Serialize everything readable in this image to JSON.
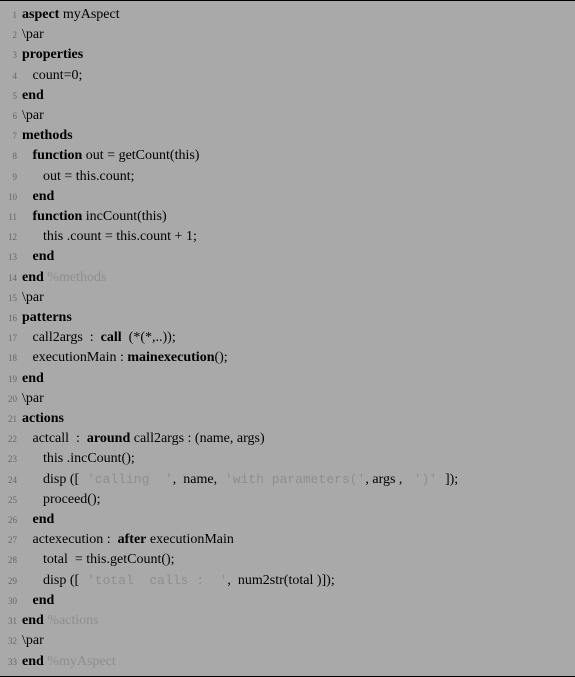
{
  "lines": [
    {
      "n": "1",
      "segs": [
        {
          "t": "aspect",
          "c": "kw"
        },
        {
          "t": " myAspect"
        }
      ]
    },
    {
      "n": "2",
      "segs": [
        {
          "t": "\\par"
        }
      ]
    },
    {
      "n": "3",
      "segs": [
        {
          "t": "properties",
          "c": "kw"
        }
      ]
    },
    {
      "n": "4",
      "segs": [
        {
          "t": "   count=0;"
        }
      ]
    },
    {
      "n": "5",
      "segs": [
        {
          "t": "end",
          "c": "kw"
        }
      ]
    },
    {
      "n": "6",
      "segs": [
        {
          "t": "\\par"
        }
      ]
    },
    {
      "n": "7",
      "segs": [
        {
          "t": "methods",
          "c": "kw"
        }
      ]
    },
    {
      "n": "8",
      "segs": [
        {
          "t": "   "
        },
        {
          "t": "function",
          "c": "kw"
        },
        {
          "t": " out = getCount(this)"
        }
      ]
    },
    {
      "n": "9",
      "segs": [
        {
          "t": "      out = this.count;"
        }
      ]
    },
    {
      "n": "10",
      "segs": [
        {
          "t": "   "
        },
        {
          "t": "end",
          "c": "kw"
        }
      ]
    },
    {
      "n": "11",
      "segs": [
        {
          "t": "   "
        },
        {
          "t": "function",
          "c": "kw"
        },
        {
          "t": " incCount(this)"
        }
      ]
    },
    {
      "n": "12",
      "segs": [
        {
          "t": "      this .count = this.count + 1;"
        }
      ]
    },
    {
      "n": "13",
      "segs": [
        {
          "t": "   "
        },
        {
          "t": "end",
          "c": "kw"
        }
      ]
    },
    {
      "n": "14",
      "segs": [
        {
          "t": "end",
          "c": "kw"
        },
        {
          "t": " "
        },
        {
          "t": "%methods",
          "c": "cmt"
        }
      ]
    },
    {
      "n": "15",
      "segs": [
        {
          "t": "\\par"
        }
      ]
    },
    {
      "n": "16",
      "segs": [
        {
          "t": "patterns",
          "c": "kw"
        }
      ]
    },
    {
      "n": "17",
      "segs": [
        {
          "t": "   call2args  :  "
        },
        {
          "t": "call",
          "c": "kw"
        },
        {
          "t": "  (*(*,..));"
        }
      ]
    },
    {
      "n": "18",
      "segs": [
        {
          "t": "   executionMain : "
        },
        {
          "t": "mainexecution",
          "c": "kw"
        },
        {
          "t": "();"
        }
      ]
    },
    {
      "n": "19",
      "segs": [
        {
          "t": "end",
          "c": "kw"
        }
      ]
    },
    {
      "n": "20",
      "segs": [
        {
          "t": "\\par"
        }
      ]
    },
    {
      "n": "21",
      "segs": [
        {
          "t": "actions",
          "c": "kw"
        }
      ]
    },
    {
      "n": "22",
      "segs": [
        {
          "t": "   actcall  :  "
        },
        {
          "t": "around",
          "c": "kw"
        },
        {
          "t": " call2args : (name, args)"
        }
      ]
    },
    {
      "n": "23",
      "segs": [
        {
          "t": "      this .incCount();"
        }
      ]
    },
    {
      "n": "24",
      "segs": [
        {
          "t": "      disp (["
        },
        {
          "t": " 'calling  '",
          "c": "str tt"
        },
        {
          "t": ",  name,"
        },
        {
          "t": " 'with parameters('",
          "c": "str tt"
        },
        {
          "t": ", args , "
        },
        {
          "t": " ')' ",
          "c": "str tt"
        },
        {
          "t": "]);"
        }
      ]
    },
    {
      "n": "25",
      "segs": [
        {
          "t": "      proceed();"
        }
      ]
    },
    {
      "n": "26",
      "segs": [
        {
          "t": "   "
        },
        {
          "t": "end",
          "c": "kw"
        }
      ]
    },
    {
      "n": "27",
      "segs": [
        {
          "t": "   actexecution :  "
        },
        {
          "t": "after",
          "c": "kw"
        },
        {
          "t": " executionMain"
        }
      ]
    },
    {
      "n": "28",
      "segs": [
        {
          "t": "      total  = this.getCount();"
        }
      ]
    },
    {
      "n": "29",
      "segs": [
        {
          "t": "      disp (["
        },
        {
          "t": " 'total  calls :  '",
          "c": "str tt"
        },
        {
          "t": ",  num2str(total )]);"
        }
      ]
    },
    {
      "n": "30",
      "segs": [
        {
          "t": "   "
        },
        {
          "t": "end",
          "c": "kw"
        }
      ]
    },
    {
      "n": "31",
      "segs": [
        {
          "t": "end",
          "c": "kw"
        },
        {
          "t": " "
        },
        {
          "t": "%actions",
          "c": "cmt"
        }
      ]
    },
    {
      "n": "32",
      "segs": [
        {
          "t": "\\par"
        }
      ]
    },
    {
      "n": "33",
      "segs": [
        {
          "t": "end",
          "c": "kw"
        },
        {
          "t": " "
        },
        {
          "t": "%myAspect",
          "c": "cmt"
        }
      ]
    }
  ]
}
